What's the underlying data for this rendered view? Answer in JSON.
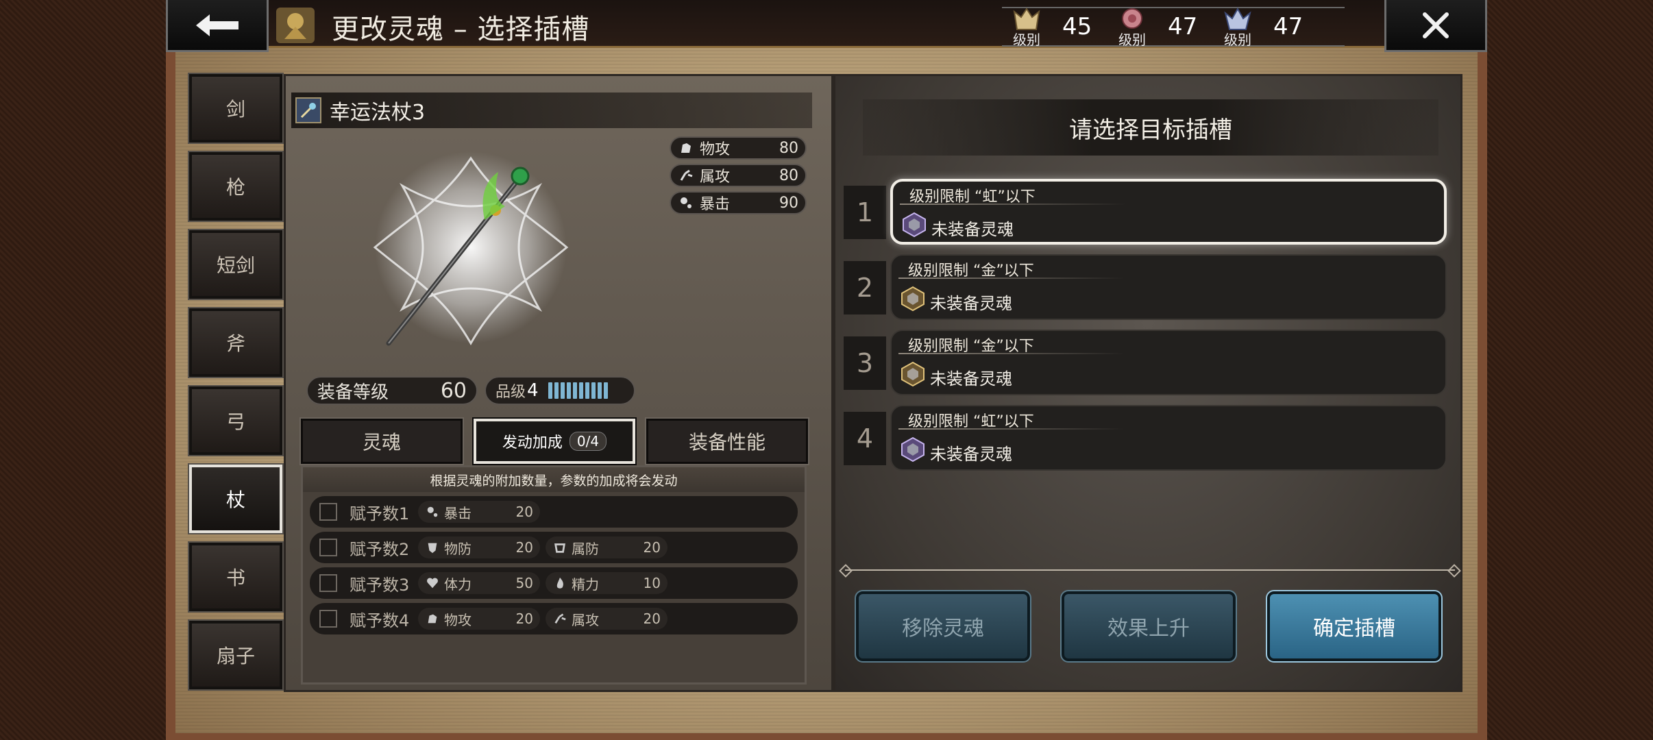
{
  "header": {
    "title": "更改灵魂 – 选择插槽",
    "levels": [
      {
        "icon": "gold-crest-icon",
        "label": "级别",
        "value": "45"
      },
      {
        "icon": "red-rose-icon",
        "label": "级别",
        "value": "47"
      },
      {
        "icon": "blue-crest-icon",
        "label": "级别",
        "value": "47"
      }
    ]
  },
  "categories": [
    {
      "label": "剑",
      "active": false
    },
    {
      "label": "枪",
      "active": false
    },
    {
      "label": "短剑",
      "active": false
    },
    {
      "label": "斧",
      "active": false
    },
    {
      "label": "弓",
      "active": false
    },
    {
      "label": "杖",
      "active": true
    },
    {
      "label": "书",
      "active": false
    },
    {
      "label": "扇子",
      "active": false
    }
  ],
  "weapon": {
    "name": "幸运法杖3",
    "stats": [
      {
        "name": "物攻",
        "value": "80"
      },
      {
        "name": "属攻",
        "value": "80"
      },
      {
        "name": "暴击",
        "value": "90"
      }
    ],
    "equip_level_label": "装备等级",
    "equip_level": "60",
    "grade_label": "品级",
    "grade": "4",
    "grade_pips": 10
  },
  "tabs": {
    "soul": "灵魂",
    "activation": "发动加成",
    "activation_count": "0/4",
    "performance": "装备性能"
  },
  "bonus": {
    "header": "根据灵魂的附加数量，参数的加成将会发动",
    "rows": [
      {
        "label": "赋予数1",
        "pills": [
          {
            "name": "暴击",
            "value": "20"
          }
        ]
      },
      {
        "label": "赋予数2",
        "pills": [
          {
            "name": "物防",
            "value": "20"
          },
          {
            "name": "属防",
            "value": "20"
          }
        ]
      },
      {
        "label": "赋予数3",
        "pills": [
          {
            "name": "体力",
            "value": "50"
          },
          {
            "name": "精力",
            "value": "10"
          }
        ]
      },
      {
        "label": "赋予数4",
        "pills": [
          {
            "name": "物攻",
            "value": "20"
          },
          {
            "name": "属攻",
            "value": "20"
          }
        ]
      }
    ]
  },
  "right": {
    "title": "请选择目标插槽",
    "slots": [
      {
        "num": "1",
        "limit": "级别限制 “虹”以下",
        "status": "未装备灵魂",
        "gem": "rainbow",
        "active": true
      },
      {
        "num": "2",
        "limit": "级别限制 “金”以下",
        "status": "未装备灵魂",
        "gem": "gold",
        "active": false
      },
      {
        "num": "3",
        "limit": "级别限制 “金”以下",
        "status": "未装备灵魂",
        "gem": "gold",
        "active": false
      },
      {
        "num": "4",
        "limit": "级别限制 “虹”以下",
        "status": "未装备灵魂",
        "gem": "rainbow",
        "active": false
      }
    ],
    "buttons": {
      "remove": "移除灵魂",
      "boost": "效果上升",
      "confirm": "确定插槽"
    }
  },
  "colors": {
    "accent_blue": "#4d90b2",
    "grade_pip": "#7fb6d3"
  }
}
